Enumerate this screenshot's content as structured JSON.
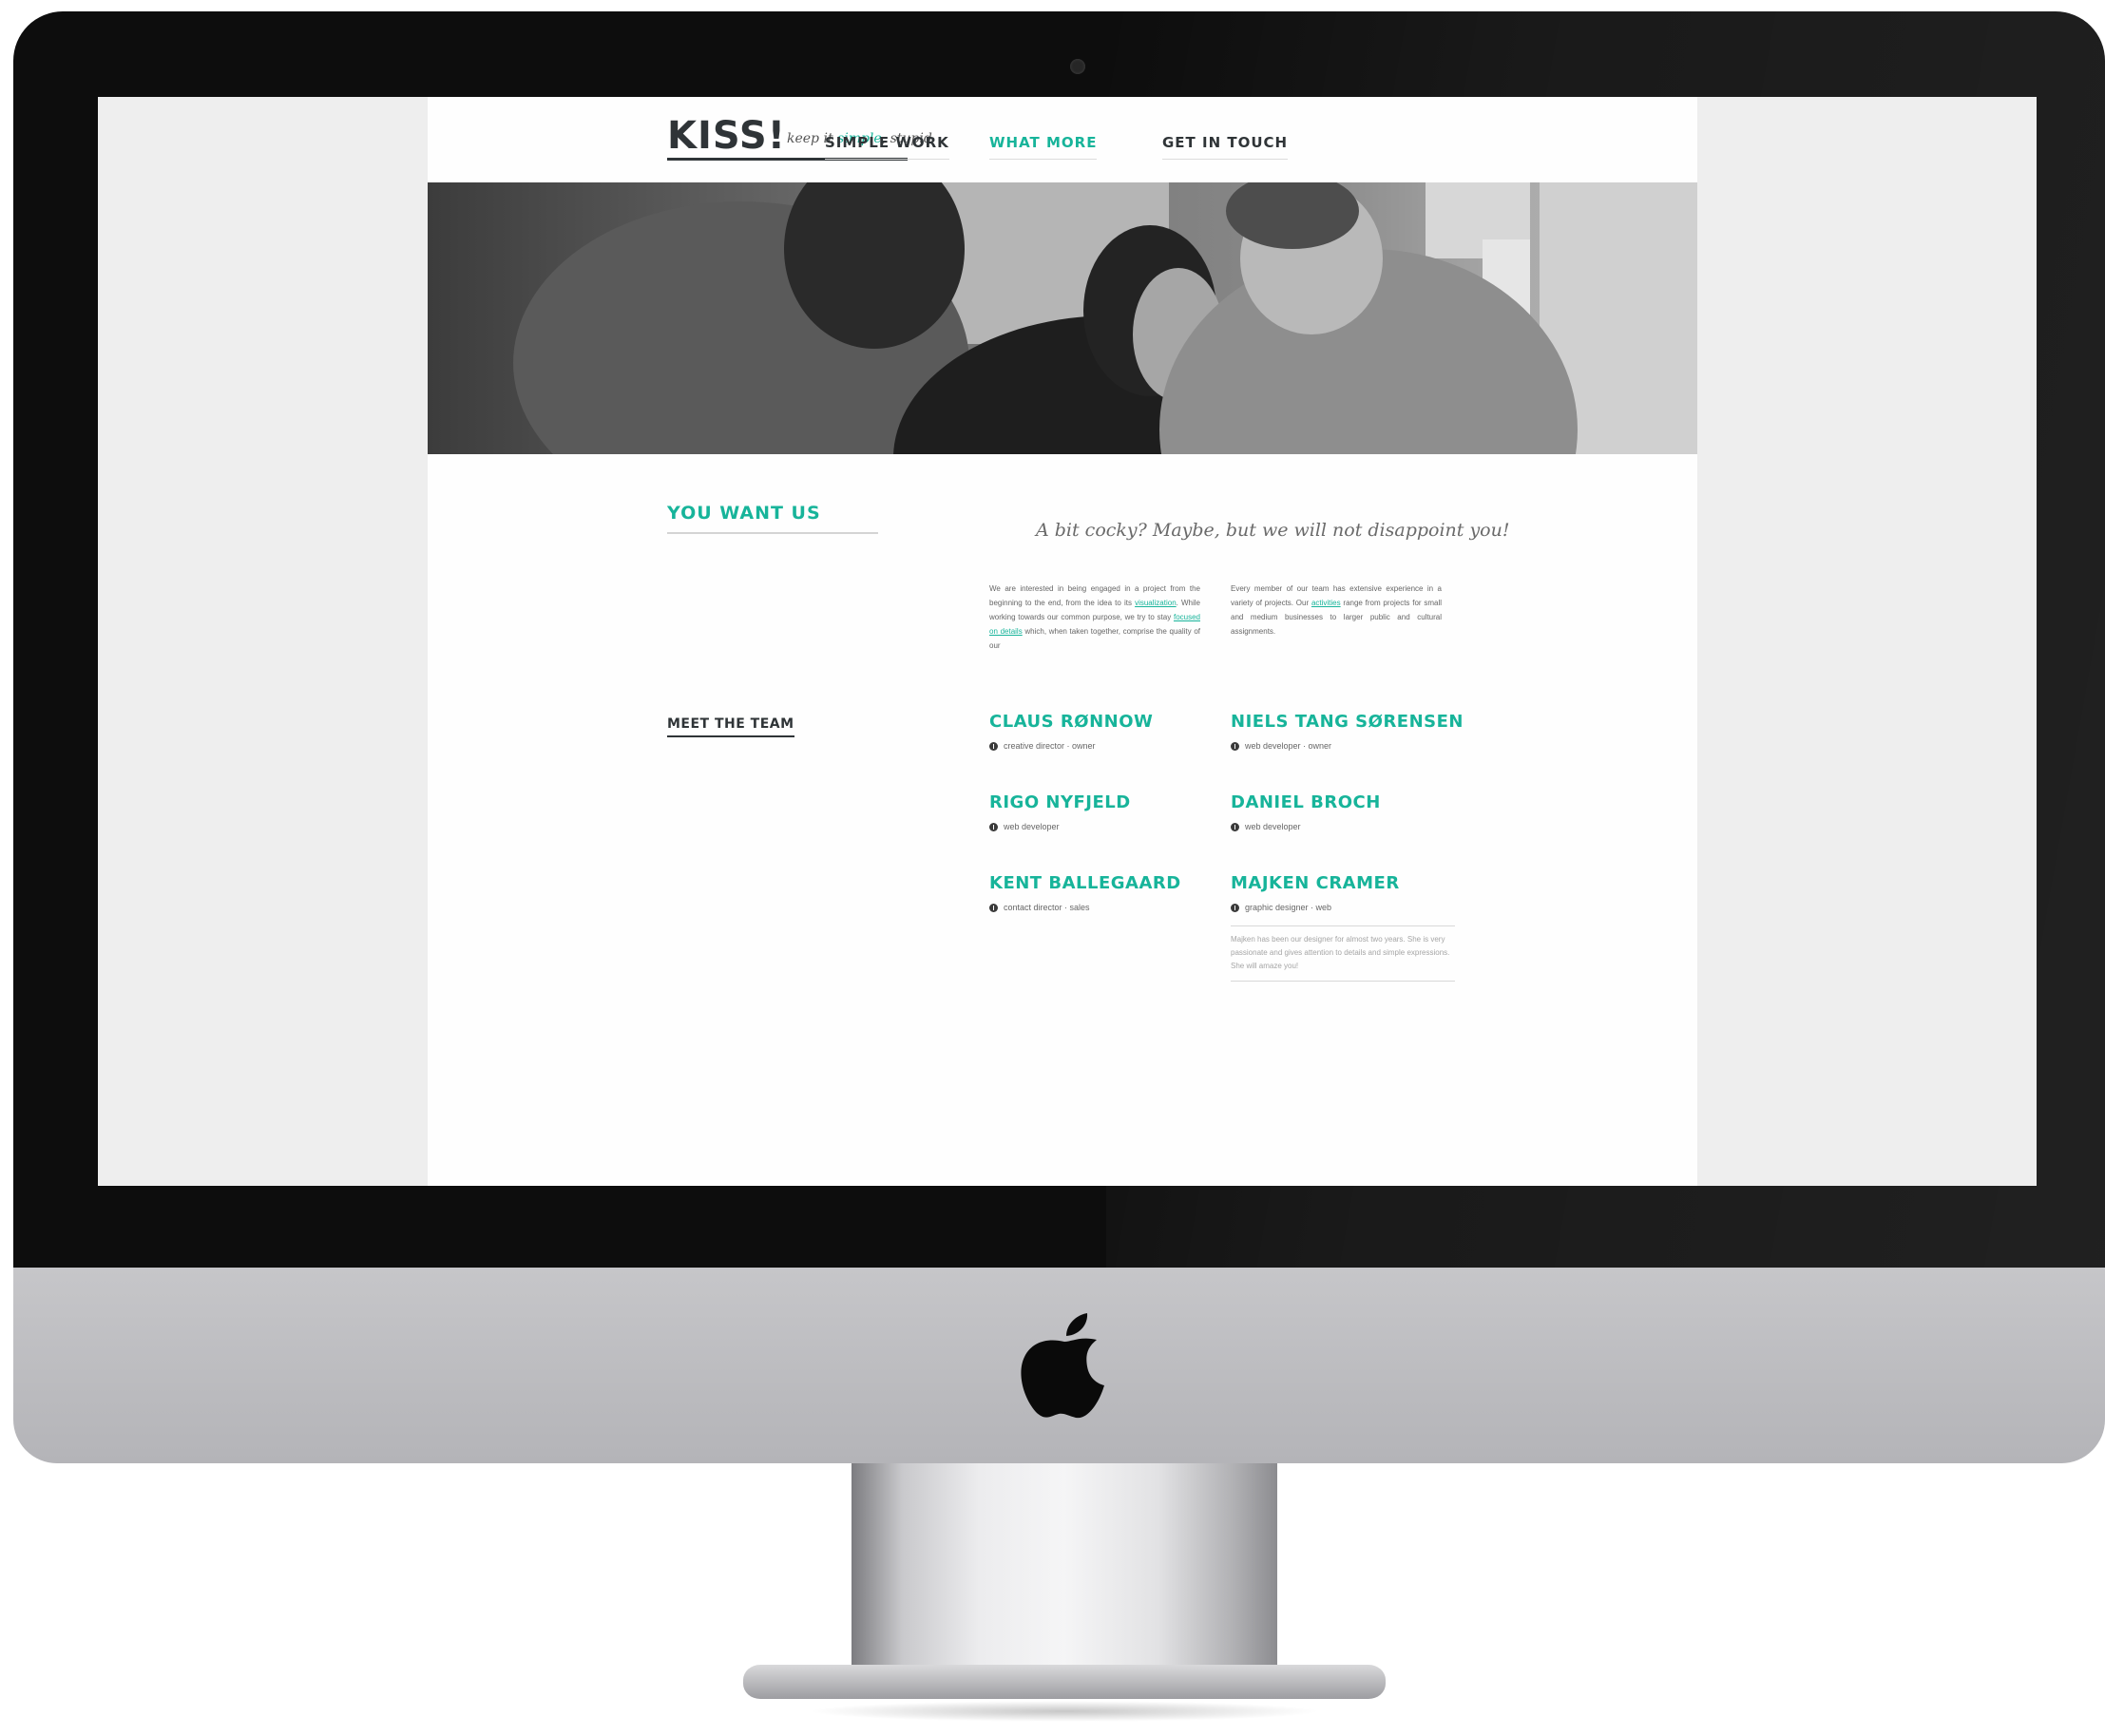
{
  "site": {
    "logo": "KISS!",
    "tagline_before": "keep it ",
    "tagline_accent": "simple",
    "tagline_after": ", stupid"
  },
  "nav": {
    "items": [
      {
        "label": "SIMPLE WORK",
        "active": false
      },
      {
        "label": "WHAT MORE",
        "active": true
      },
      {
        "label": "GET IN TOUCH",
        "active": false
      }
    ]
  },
  "intro": {
    "heading": "YOU WANT US",
    "quote": "A bit cocky? Maybe, but we will not disappoint you!",
    "col_left": {
      "p1": "We are interested in being engaged in a project from the beginning to the end, from the idea to its ",
      "link1": "visualization",
      "p2": ". While working towards our common purpose, we try to stay ",
      "link2": "focused on details",
      "p3": " which, when taken together, comprise the quality of our"
    },
    "col_right": {
      "p1": "Every member of our team has extensive experience in a variety of projects. Our ",
      "link1": "activities",
      "p2": " range from projects for small and medium businesses to larger public and cultural assignments."
    }
  },
  "team": {
    "heading": "MEET THE TEAM",
    "members": [
      {
        "name": "CLAUS RØNNOW",
        "role": "creative director · owner"
      },
      {
        "name": "NIELS TANG SØRENSEN",
        "role": "web developer · owner"
      },
      {
        "name": "RIGO NYFJELD",
        "role": "web developer"
      },
      {
        "name": "DANIEL BROCH",
        "role": "web developer"
      },
      {
        "name": "KENT BALLEGAARD",
        "role": "contact director · sales"
      },
      {
        "name": "MAJKEN CRAMER",
        "role": "graphic designer · web"
      }
    ],
    "bio": "Majken has been our designer for almost two years. She is very passionate and gives attention to details and simple expressions. She will amaze you!"
  },
  "colors": {
    "accent": "#17b49a",
    "text_dark": "#2f3437",
    "bezel": "#0d0d0d",
    "chin": "#c0c0c4"
  },
  "icons": [
    "info-icon",
    "apple-logo-icon",
    "camera-icon"
  ]
}
